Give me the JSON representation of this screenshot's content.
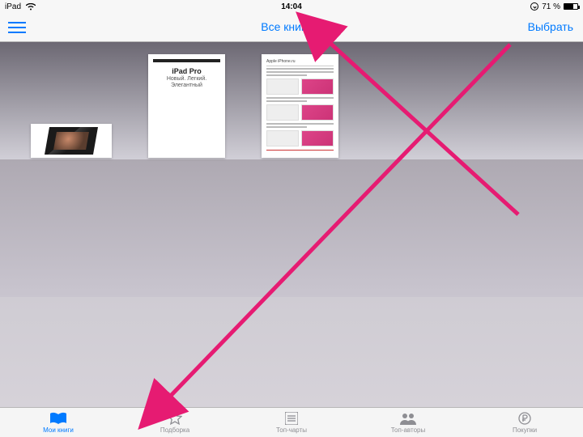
{
  "status": {
    "device": "iPad",
    "time": "14:04",
    "battery_pct": "71 %"
  },
  "nav": {
    "title": "Все книги",
    "select": "Выбрать"
  },
  "docs": {
    "d2_line1": "iPad Pro",
    "d2_line2": "Новый. Легкий. Элегантный",
    "d3_header": "Apple iPhone.ru"
  },
  "tabs": [
    {
      "label": "Мои книги"
    },
    {
      "label": "Подборка"
    },
    {
      "label": "Топ-чарты"
    },
    {
      "label": "Топ-авторы"
    },
    {
      "label": "Покупки"
    }
  ]
}
